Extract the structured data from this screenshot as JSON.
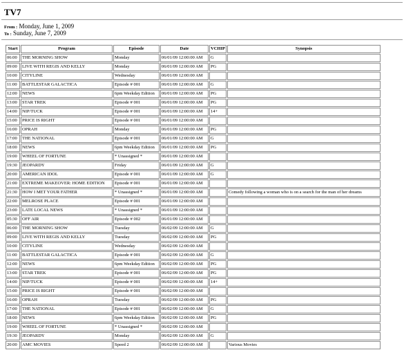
{
  "report": {
    "title": "TV7",
    "from_label": "From :",
    "from_value": "Monday, June 1, 2009",
    "to_label": "To :",
    "to_value": "Sunday, June 7, 2009"
  },
  "table": {
    "headers": [
      "Start",
      "Program",
      "Episode",
      "Date",
      "VCHIP",
      "Synopsis"
    ],
    "rows": [
      [
        "06:00",
        "THE MORNING SHOW",
        "Monday",
        "06/01/09 12:00:00 AM",
        "G",
        ""
      ],
      [
        "09:00",
        "LIVE WITH REGIS AND KELLY",
        "Monday",
        "06/01/09 12:00:00 AM",
        "PG",
        ""
      ],
      [
        "10:00",
        "CITYLINE",
        "Wednesday",
        "06/01/09 12:00:00 AM",
        "",
        ""
      ],
      [
        "11:00",
        "BATTLESTAR GALACTICA",
        "Episode # 001",
        "06/01/09 12:00:00 AM",
        "G",
        ""
      ],
      [
        "12:00",
        "NEWS",
        "6pm Weekday Edition",
        "06/01/09 12:00:00 AM",
        "PG",
        ""
      ],
      [
        "13:00",
        "STAR TREK",
        "Episode # 001",
        "06/01/09 12:00:00 AM",
        "PG",
        ""
      ],
      [
        "14:00",
        "NIP/TUCK",
        "Episode # 001",
        "06/01/09 12:00:00 AM",
        "14+",
        ""
      ],
      [
        "15:00",
        "PRICE IS RIGHT",
        "Episode # 001",
        "06/01/09 12:00:00 AM",
        "",
        ""
      ],
      [
        "16:00",
        "OPRAH",
        "Monday",
        "06/01/09 12:00:00 AM",
        "PG",
        ""
      ],
      [
        "17:00",
        "THE NATIONAL",
        "Episode # 001",
        "06/01/09 12:00:00 AM",
        "G",
        ""
      ],
      [
        "18:00",
        "NEWS",
        "6pm Weekday Edition",
        "06/01/09 12:00:00 AM",
        "PG",
        ""
      ],
      [
        "19:00",
        "WHEEL OF FORTUNE",
        "* Unassigned *",
        "06/01/09 12:00:00 AM",
        "",
        ""
      ],
      [
        "19:30",
        "JEOPARDY",
        "Friday",
        "06/01/09 12:00:00 AM",
        "G",
        ""
      ],
      [
        "20:00",
        "AMERICAN IDOL",
        "Episode # 001",
        "06/01/09 12:00:00 AM",
        "G",
        ""
      ],
      [
        "21:00",
        "EXTREME MAKEOVER: HOME EDITION",
        "Episode # 001",
        "06/01/09 12:00:00 AM",
        "",
        ""
      ],
      [
        "21:30",
        "HOW I MET YOUR FATHER",
        "* Unassigned *",
        "06/01/09 12:00:00 AM",
        "",
        "Comedy following a woman who is on a search for the man of her dreams"
      ],
      [
        "22:00",
        "MELROSE PLACE",
        "Episode # 001",
        "06/01/09 12:00:00 AM",
        "",
        ""
      ],
      [
        "23:00",
        "LATE LOCAL NEWS",
        "* Unassigned *",
        "06/01/09 12:00:00 AM",
        "",
        ""
      ],
      [
        "05:30",
        "OFF AIR",
        "Episode # 002",
        "06/01/09 12:00:00 AM",
        "",
        ""
      ],
      [
        "06:00",
        "THE MORNING SHOW",
        "Tuesday",
        "06/02/09 12:00:00 AM",
        "G",
        ""
      ],
      [
        "09:00",
        "LIVE WITH REGIS AND KELLY",
        "Tuesday",
        "06/02/09 12:00:00 AM",
        "PG",
        ""
      ],
      [
        "10:00",
        "CITYLINE",
        "Wednesday",
        "06/02/09 12:00:00 AM",
        "",
        ""
      ],
      [
        "11:00",
        "BATTLESTAR GALACTICA",
        "Episode # 001",
        "06/02/09 12:00:00 AM",
        "G",
        ""
      ],
      [
        "12:00",
        "NEWS",
        "6pm Weekday Edition",
        "06/02/09 12:00:00 AM",
        "PG",
        ""
      ],
      [
        "13:00",
        "STAR TREK",
        "Episode # 001",
        "06/02/09 12:00:00 AM",
        "PG",
        ""
      ],
      [
        "14:00",
        "NIP/TUCK",
        "Episode # 001",
        "06/02/09 12:00:00 AM",
        "14+",
        ""
      ],
      [
        "15:00",
        "PRICE IS RIGHT",
        "Episode # 001",
        "06/02/09 12:00:00 AM",
        "",
        ""
      ],
      [
        "16:00",
        "OPRAH",
        "Tuesday",
        "06/02/09 12:00:00 AM",
        "PG",
        ""
      ],
      [
        "17:00",
        "THE NATIONAL",
        "Episode # 001",
        "06/02/09 12:00:00 AM",
        "G",
        ""
      ],
      [
        "18:00",
        "NEWS",
        "6pm Weekday Edition",
        "06/02/09 12:00:00 AM",
        "PG",
        ""
      ],
      [
        "19:00",
        "WHEEL OF FORTUNE",
        "* Unassigned *",
        "06/02/09 12:00:00 AM",
        "",
        ""
      ],
      [
        "19:30",
        "JEOPARDY",
        "Monday",
        "06/02/09 12:00:00 AM",
        "G",
        ""
      ],
      [
        "20:00",
        "AMC MOVIES",
        "Speed 2",
        "06/02/09 12:00:00 AM",
        "",
        "Various Movies"
      ]
    ]
  }
}
